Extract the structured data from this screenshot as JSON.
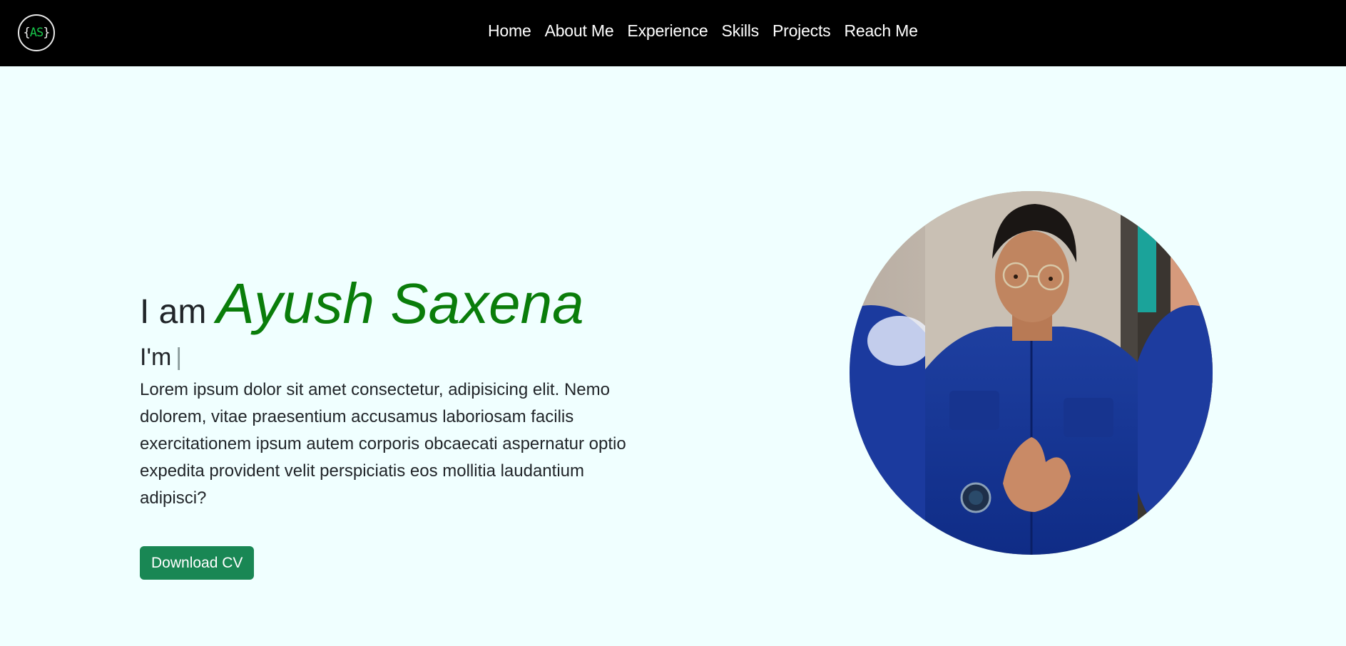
{
  "logo": {
    "left": "{",
    "text": "AS",
    "right": "}"
  },
  "nav": {
    "items": [
      "Home",
      "About Me",
      "Experience",
      "Skills",
      "Projects",
      "Reach Me"
    ]
  },
  "hero": {
    "greeting_prefix": "I am",
    "name": "Ayush Saxena",
    "typing_prefix": "I'm",
    "typing_cursor": "|",
    "description": "Lorem ipsum dolor sit amet consectetur, adipisicing elit. Nemo dolorem, vitae praesentium accusamus laboriosam facilis exercitationem ipsum autem corporis obcaecati aspernatur optio expedita provident velit perspiciatis eos mollitia laudantium adipisci?",
    "button_label": "Download CV"
  },
  "colors": {
    "nav_bg": "#000000",
    "page_bg": "#f0ffff",
    "name": "#0a7d0a",
    "button": "#198754",
    "logo_accent": "#18c44a"
  },
  "icons": {
    "profile_photo": "person-portrait"
  }
}
